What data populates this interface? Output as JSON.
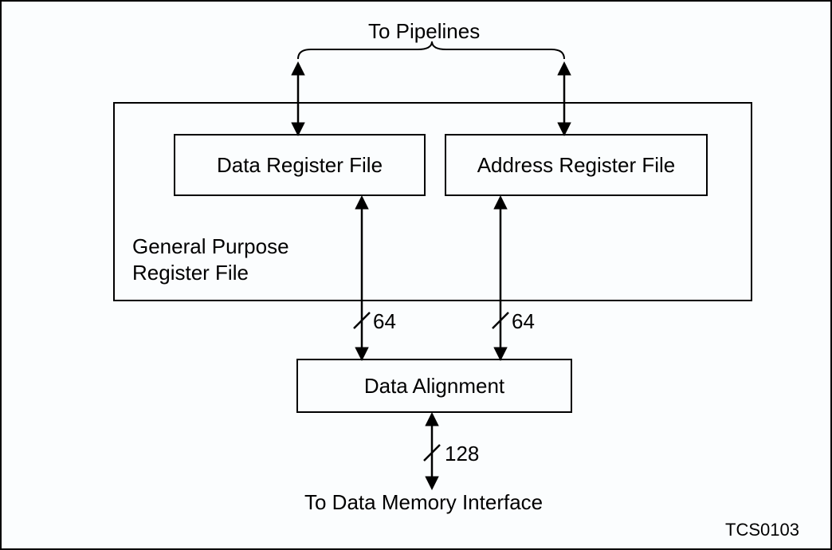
{
  "labels": {
    "to_pipelines": "To Pipelines",
    "data_register_file": "Data Register File",
    "address_register_file": "Address Register File",
    "general_purpose": "General Purpose\nRegister File",
    "data_alignment": "Data Alignment",
    "bus_left": "64",
    "bus_right": "64",
    "bus_bottom": "128",
    "to_memory": "To Data Memory Interface",
    "tag": "TCS0103"
  }
}
